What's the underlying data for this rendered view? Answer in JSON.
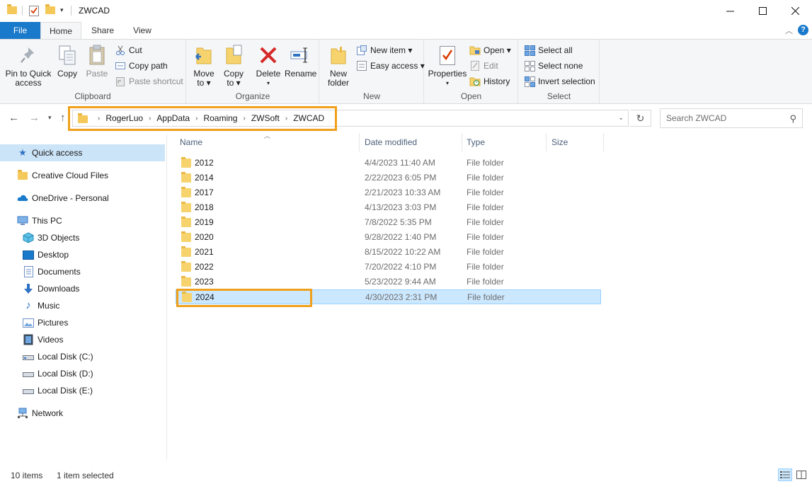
{
  "window": {
    "title": "ZWCAD",
    "controls": [
      "minimize",
      "maximize",
      "close"
    ]
  },
  "ribbon_tabs": [
    {
      "label": "File"
    },
    {
      "label": "Home"
    },
    {
      "label": "Share"
    },
    {
      "label": "View"
    }
  ],
  "ribbon": {
    "clipboard": {
      "label": "Clipboard",
      "pin_label_1": "Pin to Quick",
      "pin_label_2": "access",
      "copy_label": "Copy",
      "paste_label": "Paste",
      "cut_label": "Cut",
      "copy_path_label": "Copy path",
      "paste_shortcut_label": "Paste shortcut"
    },
    "organize": {
      "label": "Organize",
      "move_label_1": "Move",
      "move_label_2": "to ▾",
      "copy_label_1": "Copy",
      "copy_label_2": "to ▾",
      "delete_label": "Delete",
      "delete_arrow": "▾",
      "rename_label": "Rename"
    },
    "new": {
      "label": "New",
      "new_folder_label_1": "New",
      "new_folder_label_2": "folder",
      "new_item_label": "New item ▾",
      "easy_access_label": "Easy access ▾"
    },
    "open": {
      "label": "Open",
      "properties_label": "Properties",
      "properties_arrow": "▾",
      "open_label": "Open ▾",
      "edit_label": "Edit",
      "history_label": "History"
    },
    "select": {
      "label": "Select",
      "select_all_label": "Select all",
      "select_none_label": "Select none",
      "invert_label": "Invert selection"
    }
  },
  "address": {
    "crumbs": [
      "RogerLuo",
      "AppData",
      "Roaming",
      "ZWSoft",
      "ZWCAD"
    ],
    "search_placeholder": "Search ZWCAD"
  },
  "sidebar": {
    "quick_access": "Quick access",
    "creative_cloud": "Creative Cloud Files",
    "onedrive": "OneDrive - Personal",
    "this_pc": "This PC",
    "objects3d": "3D Objects",
    "desktop": "Desktop",
    "documents": "Documents",
    "downloads": "Downloads",
    "music": "Music",
    "pictures": "Pictures",
    "videos": "Videos",
    "disk_c": "Local Disk (C:)",
    "disk_d": "Local Disk (D:)",
    "disk_e": "Local Disk (E:)",
    "network": "Network"
  },
  "columns": {
    "name": "Name",
    "date": "Date modified",
    "type": "Type",
    "size": "Size"
  },
  "files": [
    {
      "name": "2012",
      "date": "4/4/2023 11:40 AM",
      "type": "File folder"
    },
    {
      "name": "2014",
      "date": "2/22/2023 6:05 PM",
      "type": "File folder"
    },
    {
      "name": "2017",
      "date": "2/21/2023 10:33 AM",
      "type": "File folder"
    },
    {
      "name": "2018",
      "date": "4/13/2023 3:03 PM",
      "type": "File folder"
    },
    {
      "name": "2019",
      "date": "7/8/2022 5:35 PM",
      "type": "File folder"
    },
    {
      "name": "2020",
      "date": "9/28/2022 1:40 PM",
      "type": "File folder"
    },
    {
      "name": "2021",
      "date": "8/15/2022 10:22 AM",
      "type": "File folder"
    },
    {
      "name": "2022",
      "date": "7/20/2022 4:10 PM",
      "type": "File folder"
    },
    {
      "name": "2023",
      "date": "5/23/2022 9:44 AM",
      "type": "File folder"
    },
    {
      "name": "2024",
      "date": "4/30/2023 2:31 PM",
      "type": "File folder",
      "selected": true
    }
  ],
  "status": {
    "count": "10 items",
    "selected": "1 item selected"
  },
  "colors": {
    "accent": "#1979ca",
    "highlight": "#f0a01a",
    "selection": "#cce8ff",
    "folder": "#f7d36e"
  }
}
